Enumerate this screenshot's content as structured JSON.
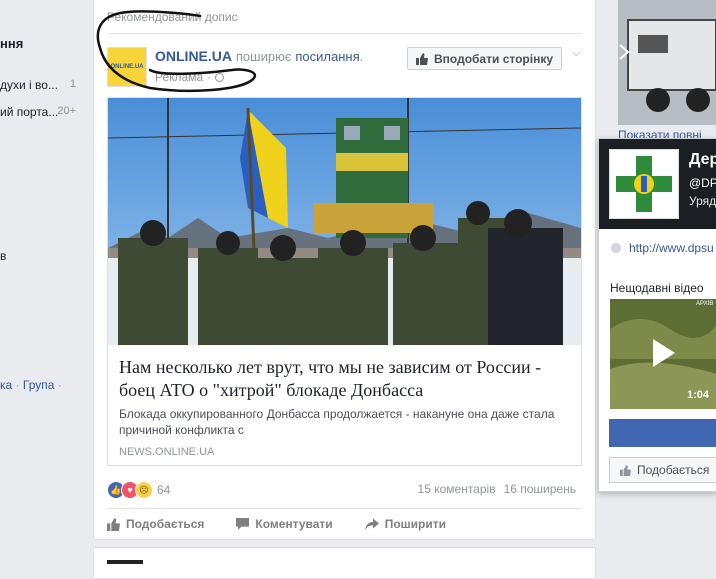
{
  "sidebar": {
    "heading": "ння",
    "items": [
      {
        "label": "духи і во...",
        "count": "1"
      },
      {
        "label": "ий порта...",
        "count": "20+"
      },
      {
        "label": "в",
        "count": ""
      }
    ],
    "links": [
      "ка",
      "Група"
    ]
  },
  "post": {
    "recommended_label": "Рекомендований допис",
    "page_name": "ONLINE.UA",
    "avatar_text": "ONLINE.UA",
    "shares_word": "поширює",
    "link_word": "посилання",
    "sponsored_label": "Реклама",
    "like_page_button": "Вподобати сторінку",
    "preview": {
      "title": "Нам несколько лет врут, что мы не зависим от России - боец АТО о \"хитрой\" блокаде Донбасса",
      "description": "Блокада оккупированного Донбасса продолжается - накануне она даже стала причиной конфликта с",
      "domain": "NEWS.ONLINE.UA"
    },
    "reactions_count": "64",
    "comments": "15 коментарів",
    "shares": "16 поширень",
    "actions": {
      "like": "Подобається",
      "comment": "Коментувати",
      "share": "Поширити"
    }
  },
  "right": {
    "related_link": "Показати повні",
    "popup": {
      "name": "Дер",
      "handle": "@DP",
      "category": "Уряд",
      "url": "http://www.dpsu",
      "recent_videos_label": "Нещодавні відео",
      "video_duration": "1:04",
      "video_overlay": "АРХІВ",
      "like_button": "Подобається"
    }
  },
  "colors": {
    "link_blue": "#365899",
    "fb_blue": "#4267b2",
    "muted": "#90949c",
    "background": "#e9ebee"
  }
}
